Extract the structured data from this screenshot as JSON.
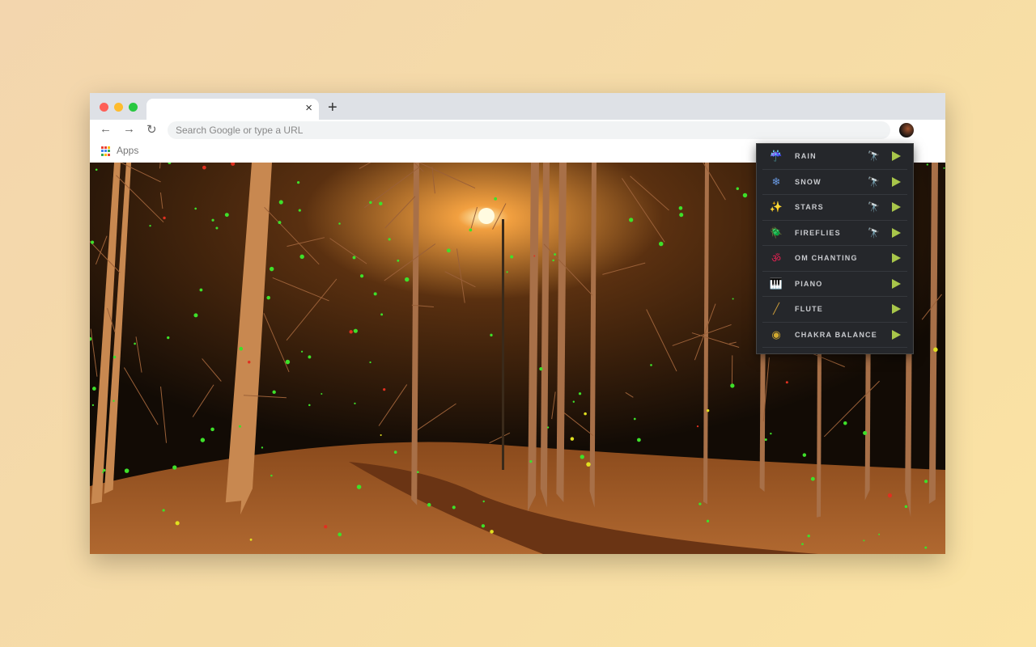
{
  "browser": {
    "tab_close": "×",
    "new_tab": "+",
    "back": "←",
    "forward": "→",
    "reload": "↻",
    "omnibox_placeholder": "Search Google or type a URL",
    "bookmark_apps": "Apps"
  },
  "traffic_lights": [
    "#fe5f57",
    "#febc2e",
    "#28c840"
  ],
  "menu": {
    "items": [
      {
        "label": "RAIN",
        "icon": "rain-cloud-icon",
        "glyph": "☔",
        "color": "#4aa8d8",
        "telescope": true
      },
      {
        "label": "SNOW",
        "icon": "snowflake-icon",
        "glyph": "❄",
        "color": "#6b9de8",
        "telescope": true
      },
      {
        "label": "STARS",
        "icon": "stars-icon",
        "glyph": "✨",
        "color": "#e8c21a",
        "telescope": true
      },
      {
        "label": "FIREFLIES",
        "icon": "fireflies-icon",
        "glyph": "🪲",
        "color": "#8fd6a0",
        "telescope": true
      },
      {
        "label": "OM CHANTING",
        "icon": "om-icon",
        "glyph": "ॐ",
        "color": "#e02050",
        "telescope": false
      },
      {
        "label": "PIANO",
        "icon": "piano-icon",
        "glyph": "🎹",
        "color": "#d040c0",
        "telescope": false
      },
      {
        "label": "FLUTE",
        "icon": "flute-icon",
        "glyph": "╱",
        "color": "#c89a3a",
        "telescope": false
      },
      {
        "label": "CHAKRA BALANCE",
        "icon": "chakra-icon",
        "glyph": "◉",
        "color": "#d0a830",
        "telescope": false
      }
    ],
    "telescope_glyph": "🔭",
    "play_color": "#a8c64a"
  }
}
